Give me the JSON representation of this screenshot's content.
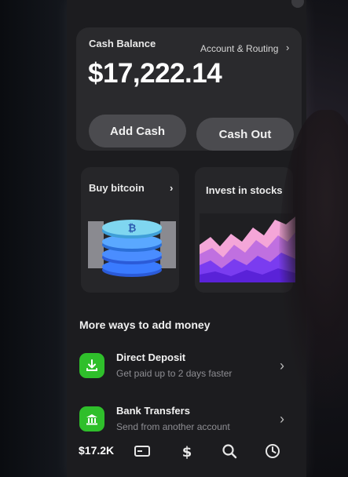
{
  "balance": {
    "label": "Cash Balance",
    "routing_link": "Account & Routing",
    "amount": "$17,222.14",
    "add_cash": "Add Cash",
    "cash_out": "Cash Out"
  },
  "tiles": {
    "bitcoin": "Buy bitcoin",
    "stocks": "Invest in stocks"
  },
  "more": {
    "title": "More ways to add money",
    "items": [
      {
        "title": "Direct Deposit",
        "subtitle": "Get paid up to 2 days faster",
        "icon": "download-icon"
      },
      {
        "title": "Bank Transfers",
        "subtitle": "Send from another account",
        "icon": "bank-icon"
      }
    ]
  },
  "tabbar": {
    "balance": "$17.2K",
    "icons": [
      "card-icon",
      "dollar-icon",
      "search-icon",
      "clock-icon"
    ]
  },
  "colors": {
    "accent_green": "#2fbf2b",
    "card_bg": "#2a2a2d",
    "pill_bg": "#4b4b4f",
    "screen_bg": "#1c1c1f"
  }
}
